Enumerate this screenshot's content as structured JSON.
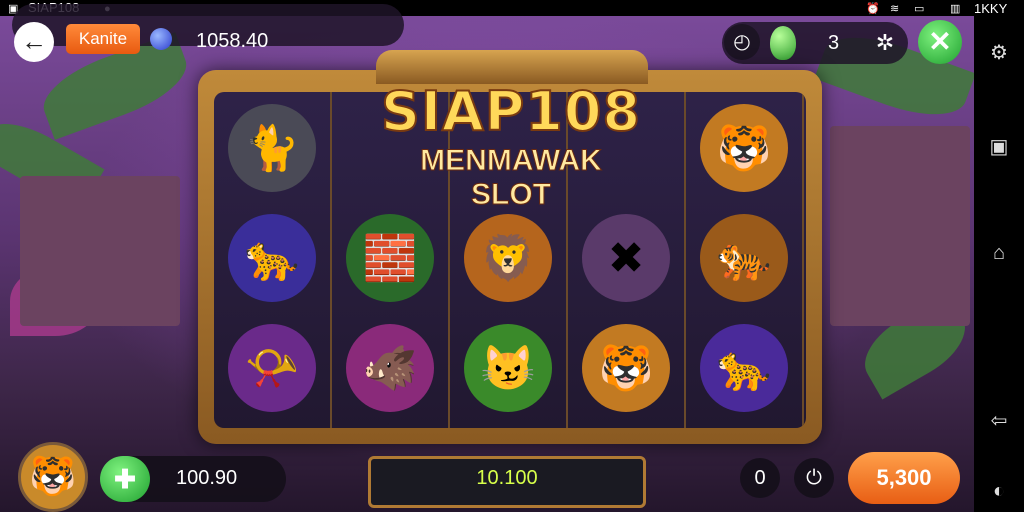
{
  "status_bar": {
    "app_title": "SIAP108",
    "right_text": "1KKY"
  },
  "top_hud": {
    "tag_label": "Kanite",
    "balance": "1058.40",
    "gems": "3"
  },
  "title": {
    "line1": "SIAP108",
    "line2": "MENMAWAK SLOT"
  },
  "reels": [
    {
      "symbols": [
        {
          "icon": "panther-icon",
          "char": "🐈",
          "bg": "#4a4a56"
        },
        {
          "icon": "blue-panther-icon",
          "char": "🐆",
          "bg": "#3a2e9a"
        },
        {
          "icon": "horn-icon",
          "char": "📯",
          "bg": "#6a2a8a"
        }
      ]
    },
    {
      "symbols": [
        {
          "icon": "empty",
          "char": "",
          "bg": "transparent"
        },
        {
          "icon": "green-block-icon",
          "char": "🧱",
          "bg": "#2a6a2a"
        },
        {
          "icon": "pink-beast-icon",
          "char": "🐗",
          "bg": "#8a2a7a"
        }
      ]
    },
    {
      "symbols": [
        {
          "icon": "empty",
          "char": "",
          "bg": "transparent"
        },
        {
          "icon": "lion-icon",
          "char": "🦁",
          "bg": "#b5651d"
        },
        {
          "icon": "green-cat-icon",
          "char": "😼",
          "bg": "#3a8a2a"
        }
      ]
    },
    {
      "symbols": [
        {
          "icon": "empty",
          "char": "",
          "bg": "transparent"
        },
        {
          "icon": "crossed-sticks-icon",
          "char": "✖",
          "bg": "#5a3a6a"
        },
        {
          "icon": "tiger-icon",
          "char": "🐯",
          "bg": "#c27a22"
        }
      ]
    },
    {
      "symbols": [
        {
          "icon": "tiger-icon",
          "char": "🐯",
          "bg": "#c27a22"
        },
        {
          "icon": "crowned-tiger-icon",
          "char": "🐅",
          "bg": "#9a5a1a"
        },
        {
          "icon": "purple-panther-icon",
          "char": "🐆",
          "bg": "#4a2a9a"
        }
      ]
    }
  ],
  "bottom_hud": {
    "bet_value": "100.90",
    "win_value": "10.100",
    "zero_value": "0",
    "spin_label": "5,300"
  },
  "colors": {
    "accent_orange": "#e85e14",
    "accent_green": "#1fa02f",
    "win_yellow": "#d7ff4a"
  }
}
